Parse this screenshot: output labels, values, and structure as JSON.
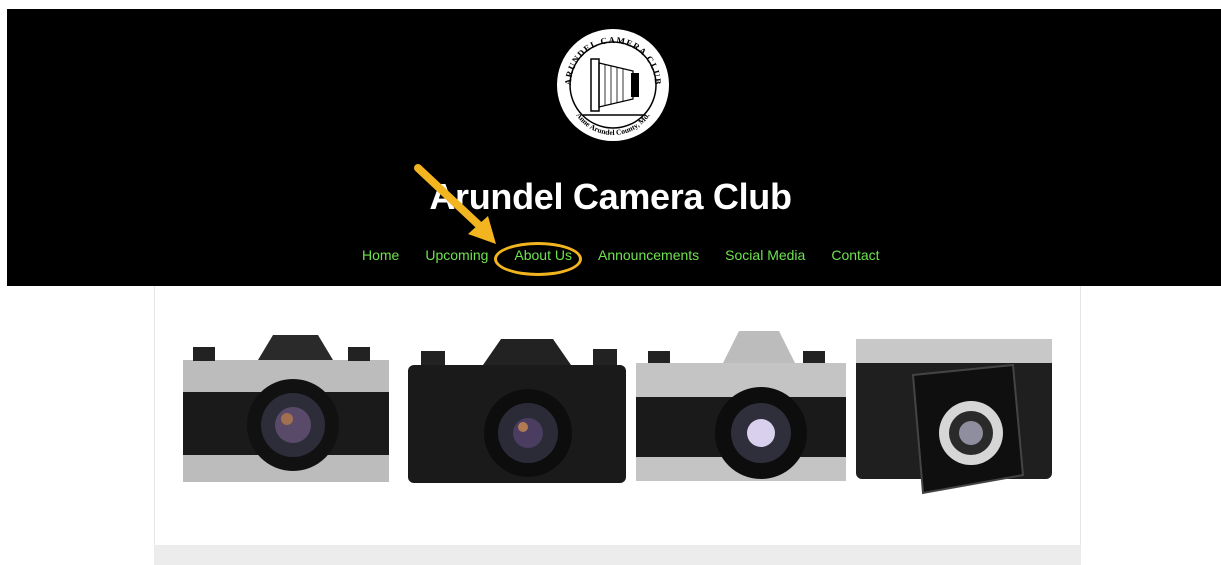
{
  "site": {
    "title": "Arundel Camera Club",
    "logo_top_text": "ARUNDEL CAMERA CLUB",
    "logo_bottom_text": "Anne Arundel County, Md."
  },
  "nav": {
    "items": [
      {
        "label": "Home"
      },
      {
        "label": "Upcoming"
      },
      {
        "label": "About Us"
      },
      {
        "label": "Announcements"
      },
      {
        "label": "Social Media"
      },
      {
        "label": "Contact"
      }
    ]
  },
  "colors": {
    "header_bg": "#000000",
    "nav_text": "#6ee34e",
    "highlight": "#f3b51f"
  },
  "banner": {
    "icon": "vintage-cameras-image"
  }
}
